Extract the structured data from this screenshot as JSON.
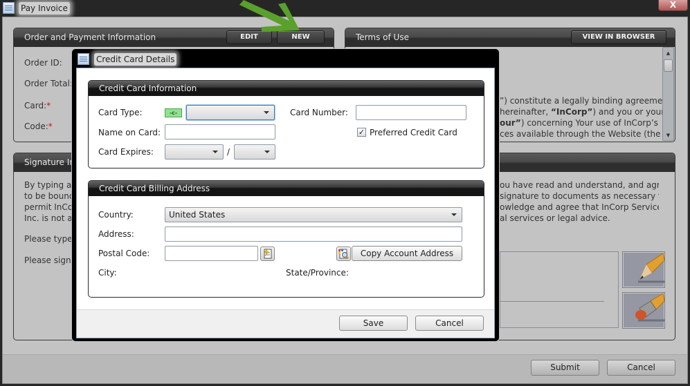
{
  "window": {
    "title": "Pay Invoice",
    "close_label": "X",
    "icon": "document-list-icon"
  },
  "order_panel": {
    "title": "Order and Payment Information",
    "edit_label": "EDIT",
    "new_label": "NEW",
    "fields": [
      {
        "label": "Order ID:",
        "required": false
      },
      {
        "label": "Order Total:",
        "required": false
      },
      {
        "label": "Card:",
        "required": true
      },
      {
        "label": "Code:",
        "required": true
      }
    ],
    "required_marker": "*"
  },
  "terms_panel": {
    "title": "Terms of Use",
    "view_label": "VIEW IN BROWSER",
    "lines": [
      "”) constitute a legally binding agreement",
      "hereinafter, “InCorp”) and you or your",
      "our”) concerning Your use of InCorp’s",
      "ces available through the Website (the"
    ]
  },
  "signature_panel": {
    "title": "Signature In",
    "left_lines": [
      "By typing ar",
      "to be bound",
      "permit InCor",
      "Inc. is not a"
    ],
    "type_prompt": "Please type",
    "sign_prompt": "Please sign y",
    "right_lines": [
      "ou have read and understand, and agree",
      "signature to documents as necessary to",
      "owledge and agree that InCorp Services,",
      "al services or legal advice."
    ],
    "pencil_tool": "pencil-icon",
    "eraser_tool": "eraser-icon"
  },
  "footer": {
    "submit_label": "Submit",
    "cancel_label": "Cancel"
  },
  "dialog": {
    "title": "Credit Card Details",
    "card_info": {
      "title": "Credit Card Information",
      "card_type_label": "Card Type:",
      "card_type_value": "",
      "card_icon_text": "-c-",
      "name_label": "Name on Card:",
      "name_value": "",
      "expires_label": "Card Expires:",
      "expires_month": "",
      "expires_year": "",
      "expires_separator": "/",
      "number_label": "Card Number:",
      "number_value": "",
      "preferred_label": "Preferred Credit Card",
      "preferred_checked": true
    },
    "billing": {
      "title": "Credit Card Billing Address",
      "country_label": "Country:",
      "country_value": "United States",
      "address_label": "Address:",
      "address_value": "",
      "postal_label": "Postal Code:",
      "postal_value": "",
      "city_label": "City:",
      "state_label": "State/Province:",
      "copy_label": "Copy Account Address"
    },
    "save_label": "Save",
    "cancel_label": "Cancel"
  },
  "annotation": {
    "arrow_color": "#5aa02c"
  }
}
